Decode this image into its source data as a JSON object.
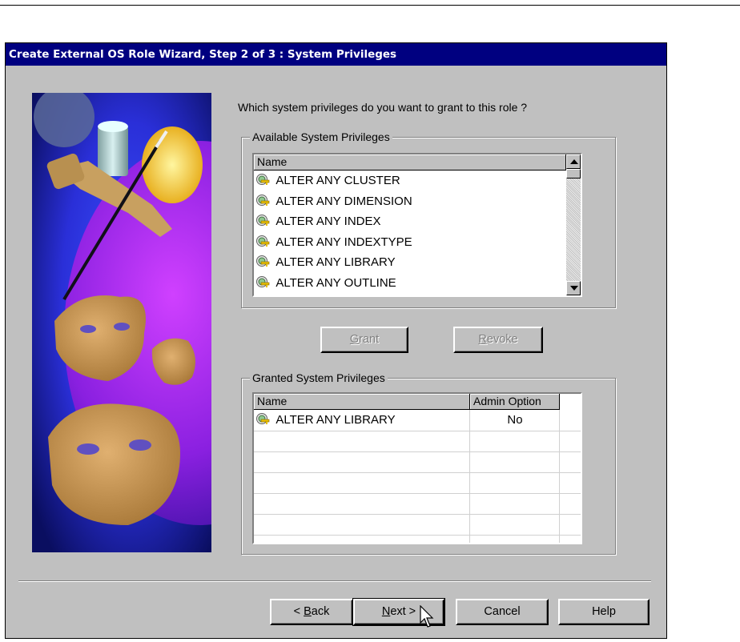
{
  "window": {
    "title": "Create External OS Role Wizard, Step 2 of 3 : System Privileges"
  },
  "prompt": "Which system privileges do you want to grant to this role ?",
  "available": {
    "legend": "Available System Privileges",
    "column_name": "Name",
    "icon": "role-key-icon",
    "items": [
      "ALTER ANY CLUSTER",
      "ALTER ANY DIMENSION",
      "ALTER ANY INDEX",
      "ALTER ANY INDEXTYPE",
      "ALTER ANY LIBRARY",
      "ALTER ANY OUTLINE"
    ]
  },
  "actions": {
    "grant": {
      "prefix": "",
      "mnemonic": "G",
      "rest": "rant"
    },
    "revoke": {
      "prefix": "",
      "mnemonic": "R",
      "rest": "evoke"
    }
  },
  "granted": {
    "legend": "Granted System Privileges",
    "column_name": "Name",
    "column_admin": "Admin Option",
    "rows": [
      {
        "name": "ALTER ANY LIBRARY",
        "admin": "No"
      }
    ]
  },
  "footer": {
    "back": {
      "prefix": "< ",
      "mnemonic": "B",
      "rest": "ack"
    },
    "next": {
      "prefix": "",
      "mnemonic": "N",
      "rest": "ext >"
    },
    "cancel": "Cancel",
    "help": "Help"
  },
  "colors": {
    "title_bar": "#000080",
    "dialog_face": "#c0c0c0"
  }
}
